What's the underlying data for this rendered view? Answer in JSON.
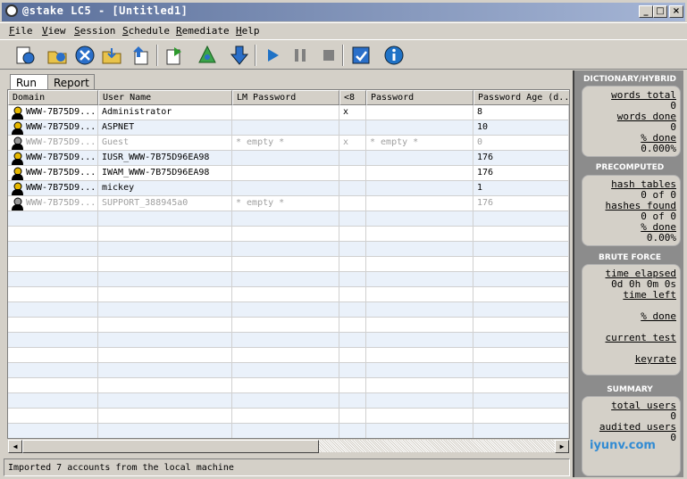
{
  "window": {
    "title": "@stake LC5 - [Untitled1]"
  },
  "menu": [
    {
      "label": "File",
      "u": "F",
      "rest": "ile"
    },
    {
      "label": "View",
      "u": "V",
      "rest": "iew"
    },
    {
      "label": "Session",
      "u": "S",
      "rest": "ession"
    },
    {
      "label": "Schedule",
      "u": "S",
      "rest": "chedule"
    },
    {
      "label": "Remediate",
      "u": "R",
      "rest": "emediate"
    },
    {
      "label": "Help",
      "u": "H",
      "rest": "elp"
    }
  ],
  "tabs": {
    "run": "Run",
    "report": "Report"
  },
  "columns": [
    "Domain",
    "User Name",
    "LM Password",
    "<8",
    "Password",
    "Password Age (d..."
  ],
  "rows": [
    {
      "domain": "WWW-7B75D9...",
      "user": "Administrator",
      "lm": "",
      "lt8": "x",
      "password": "",
      "age": "8",
      "disabled": false
    },
    {
      "domain": "WWW-7B75D9...",
      "user": "ASPNET",
      "lm": "",
      "lt8": "",
      "password": "",
      "age": "10",
      "disabled": false
    },
    {
      "domain": "WWW-7B75D9...",
      "user": "Guest",
      "lm": "* empty *",
      "lt8": "x",
      "password": "* empty *",
      "age": "0",
      "disabled": true
    },
    {
      "domain": "WWW-7B75D9...",
      "user": "IUSR_WWW-7B75D96EA98",
      "lm": "",
      "lt8": "",
      "password": "",
      "age": "176",
      "disabled": false
    },
    {
      "domain": "WWW-7B75D9...",
      "user": "IWAM_WWW-7B75D96EA98",
      "lm": "",
      "lt8": "",
      "password": "",
      "age": "176",
      "disabled": false
    },
    {
      "domain": "WWW-7B75D9...",
      "user": "mickey",
      "lm": "",
      "lt8": "",
      "password": "",
      "age": "1",
      "disabled": false
    },
    {
      "domain": "WWW-7B75D9...",
      "user": "SUPPORT_388945a0",
      "lm": "* empty *",
      "lt8": "",
      "password": "",
      "age": "176",
      "disabled": true
    }
  ],
  "status": "Imported 7 accounts from the local machine",
  "side": {
    "dictionary": {
      "title": "DICTIONARY/HYBRID",
      "words_total_label": "words total",
      "words_total": "0",
      "words_done_label": "words done",
      "words_done": "0",
      "pct_done_label": "% done",
      "pct_done": "0.000%"
    },
    "precomputed": {
      "title": "PRECOMPUTED",
      "hash_tables_label": "hash tables",
      "hash_tables": "0 of 0",
      "hashes_found_label": "hashes found",
      "hashes_found": "0 of 0",
      "pct_done_label": "% done",
      "pct_done": "0.00%"
    },
    "brute": {
      "title": "BRUTE FORCE",
      "time_elapsed_label": "time elapsed",
      "time_elapsed": "0d 0h 0m 0s",
      "time_left_label": "time left",
      "pct_done_label": "% done",
      "current_test_label": "current test",
      "keyrate_label": "keyrate"
    },
    "summary": {
      "title": "SUMMARY",
      "total_users_label": "total users",
      "total_users": "0",
      "audited_users_label": "audited users",
      "audited_users": "0"
    }
  },
  "watermark": "iyunv.com"
}
